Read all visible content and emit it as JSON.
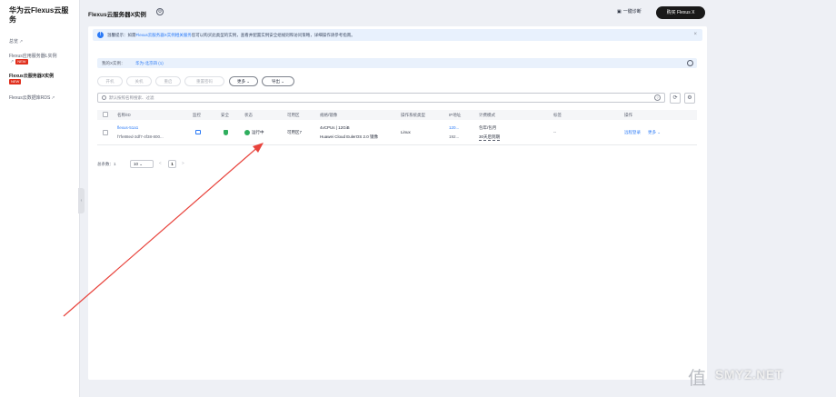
{
  "sidebar": {
    "brand": "华为云Flexus云服务",
    "items": [
      {
        "label": "总览",
        "ext": true,
        "new": false
      },
      {
        "label": "Flexus应用服务器L实例",
        "ext": true,
        "new": true
      },
      {
        "label": "Flexus云服务器X实例",
        "ext": false,
        "new": true,
        "active": true
      },
      {
        "label": "Flexus云数据库RDS",
        "ext": true,
        "new": false
      }
    ],
    "new_badge": "NEW"
  },
  "header": {
    "title": "Flexus云服务器X实例",
    "reset_label": "一键诊断",
    "buy_label": "购买 Flexus X"
  },
  "notice": {
    "prefix": "温馨提示：如需",
    "link": "Flexus云服务器X实例相关服务",
    "text": "您可以购买此类型的实例，查看并配置实例安全组规则和访问策略，详细操作请参考指南。",
    "close": "×"
  },
  "filter": {
    "label": "我的X实例：",
    "value": "华为-北京四 (1)"
  },
  "toolbar": {
    "buttons": [
      {
        "label": "开机",
        "enabled": false
      },
      {
        "label": "关机",
        "enabled": false
      },
      {
        "label": "重启",
        "enabled": false
      },
      {
        "label": "重置密码",
        "enabled": false
      },
      {
        "label": "更多 ⌄",
        "enabled": true
      },
      {
        "label": "导出 ⌄",
        "enabled": true
      }
    ]
  },
  "search": {
    "placeholder": "默认按照名称搜索、过滤"
  },
  "table": {
    "headers": [
      "名称/ID",
      "监控",
      "安全",
      "状态",
      "可用区",
      "规格/镜像",
      "操作系统类型",
      "IP地址",
      "计费模式",
      "标签",
      "操作"
    ],
    "rows": [
      {
        "name": "flexus-51a1",
        "id": "f7fe88ed-3df7-4f38-800...",
        "status": "运行中",
        "zone": "可用区7",
        "spec": "4vCPUs | 12GiB",
        "image": "Huawei Cloud EulerOS 2.0 镜像",
        "os": "Linux",
        "ip1": "120...",
        "ip2": "192...",
        "billing1": "包年/包月",
        "billing2": "30天后到期",
        "tags": "--",
        "action1": "远程登录",
        "action2": "更多 ⌄"
      }
    ]
  },
  "pager": {
    "total": "总条数：1",
    "size": "10 ⌄",
    "prev": "<",
    "page": "1",
    "next": ">"
  },
  "watermark": {
    "logo": "值",
    "text": "SMYZ.NET"
  },
  "colors": {
    "accent": "#2a7af7",
    "running": "#2fae5e",
    "new_badge": "#e0301e",
    "annotation_arrow": "#e8433c"
  }
}
